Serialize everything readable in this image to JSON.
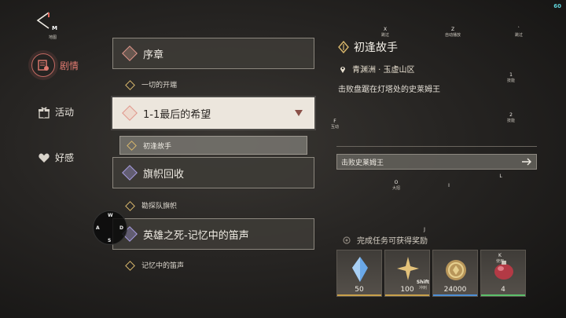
{
  "fps": "60",
  "top_left": {
    "map_key": "M",
    "map_label": "地图"
  },
  "nav": [
    {
      "label": "剧情",
      "active": true
    },
    {
      "label": "活动",
      "active": false
    },
    {
      "label": "好感",
      "active": false
    }
  ],
  "chapters": [
    {
      "title": "序章",
      "type": "red",
      "sub": [
        {
          "title": "一切的开端"
        }
      ]
    },
    {
      "title": "1-1最后的希望",
      "type": "red",
      "selected": true,
      "sub": [
        {
          "title": "初逢故手",
          "current": true
        }
      ]
    },
    {
      "title": "旗帜回收",
      "type": "purple",
      "sub": [
        {
          "title": "勘探队旗帜"
        }
      ]
    },
    {
      "title": "英雄之死-记忆中的笛声",
      "type": "purple",
      "sub": [
        {
          "title": "记忆中的笛声"
        }
      ]
    }
  ],
  "quest": {
    "title": "初逢故手",
    "location": "青渊洲 · 玉虚山区",
    "description": "击败盘踞在灯塔处的史莱姆王",
    "objective": "击败史莱姆王",
    "reward_label": "完成任务可获得奖励"
  },
  "rewards": [
    {
      "icon": "blue-crystal-icon",
      "count": "50",
      "bar_color": "#c9a14a"
    },
    {
      "icon": "gold-star-icon",
      "count": "100",
      "bar_color": "#c9a14a"
    },
    {
      "icon": "gold-coin-icon",
      "count": "24000",
      "bar_color": "#4d8fd6"
    },
    {
      "icon": "red-potion-icon",
      "count": "4",
      "bar_color": "#5cc06a"
    }
  ],
  "key_hints": {
    "x": {
      "key": "X",
      "label": "跳过"
    },
    "z": {
      "key": "Z",
      "label": "自动播放"
    },
    "dot": {
      "key": "`",
      "label": "跳过"
    },
    "one": {
      "key": "1",
      "label": "技能"
    },
    "two": {
      "key": "2",
      "label": "技能"
    },
    "f": {
      "key": "F",
      "label": "互动"
    },
    "o": {
      "key": "O",
      "label": "大招"
    },
    "i": {
      "key": "I"
    },
    "l": {
      "key": "L"
    },
    "j": {
      "key": "J"
    },
    "k": {
      "key": "K",
      "label": "使用"
    },
    "shift": {
      "key": "Shift",
      "label": "冲刺"
    }
  },
  "joystick": {
    "w": "W",
    "a": "A",
    "s": "S",
    "d": "D"
  },
  "colors": {
    "accent": "#e07a70",
    "panel": "#3e3b37",
    "selected": "#ece6dd"
  }
}
